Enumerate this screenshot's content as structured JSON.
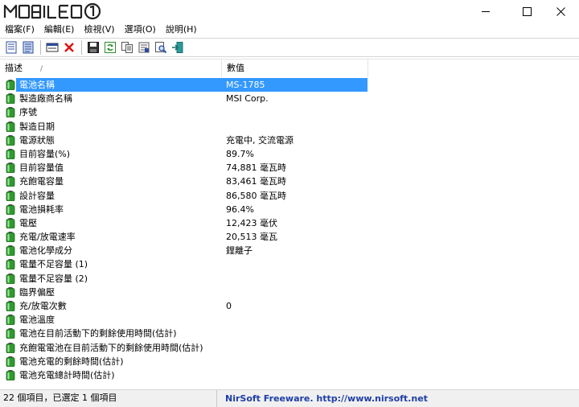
{
  "window": {
    "logo_text": "MOBILE01",
    "controls": {
      "minimize": "—",
      "maximize": "☐",
      "close": "✕"
    }
  },
  "menu": [
    {
      "label": "檔案(F)"
    },
    {
      "label": "編輯(E)"
    },
    {
      "label": "檢視(V)"
    },
    {
      "label": "選項(O)"
    },
    {
      "label": "說明(H)"
    }
  ],
  "toolbar": {
    "buttons": [
      "html-report-icon",
      "text-report-icon",
      "properties-icon",
      "delete-icon",
      "save-icon",
      "refresh-icon",
      "copy-icon",
      "options-icon",
      "find-icon",
      "exit-icon"
    ]
  },
  "list": {
    "columns": [
      {
        "label": "描述",
        "sort_indicator": "/"
      },
      {
        "label": "數值"
      }
    ],
    "rows": [
      {
        "name": "電池名稱",
        "value": "MS-1785",
        "selected": true
      },
      {
        "name": "製造廠商名稱",
        "value": "MSI Corp."
      },
      {
        "name": "序號",
        "value": ""
      },
      {
        "name": "製造日期",
        "value": ""
      },
      {
        "name": "電源狀態",
        "value": "充電中, 交流電源"
      },
      {
        "name": "目前容量(%)",
        "value": "89.7%"
      },
      {
        "name": "目前容量值",
        "value": "74,881 毫瓦時"
      },
      {
        "name": "充飽電容量",
        "value": "83,461 毫瓦時"
      },
      {
        "name": "設計容量",
        "value": "86,580 毫瓦時"
      },
      {
        "name": "電池損耗率",
        "value": "96.4%"
      },
      {
        "name": "電壓",
        "value": "12,423 毫伏"
      },
      {
        "name": "充電/放電速率",
        "value": "20,513 毫瓦"
      },
      {
        "name": "電池化學成分",
        "value": "鋰離子"
      },
      {
        "name": "電量不足容量 (1)",
        "value": ""
      },
      {
        "name": "電量不足容量 (2)",
        "value": ""
      },
      {
        "name": "臨界偏壓",
        "value": ""
      },
      {
        "name": "充/放電次數",
        "value": "0"
      },
      {
        "name": "電池溫度",
        "value": ""
      },
      {
        "name": "電池在目前活動下的剩餘使用時間(估計)",
        "value": ""
      },
      {
        "name": "充飽電電池在目前活動下的剩餘使用時間(估計)",
        "value": ""
      },
      {
        "name": "電池充電的剩餘時間(估計)",
        "value": ""
      },
      {
        "name": "電池充電總計時間(估計)",
        "value": ""
      }
    ]
  },
  "status": {
    "left": "22 個項目，已選定 1 個項目",
    "right": "NirSoft Freeware.  http://www.nirsoft.net"
  },
  "colors": {
    "selection": "#3399ff",
    "battery_green": "#2e9b2e",
    "link_blue": "#1f3ea8"
  }
}
